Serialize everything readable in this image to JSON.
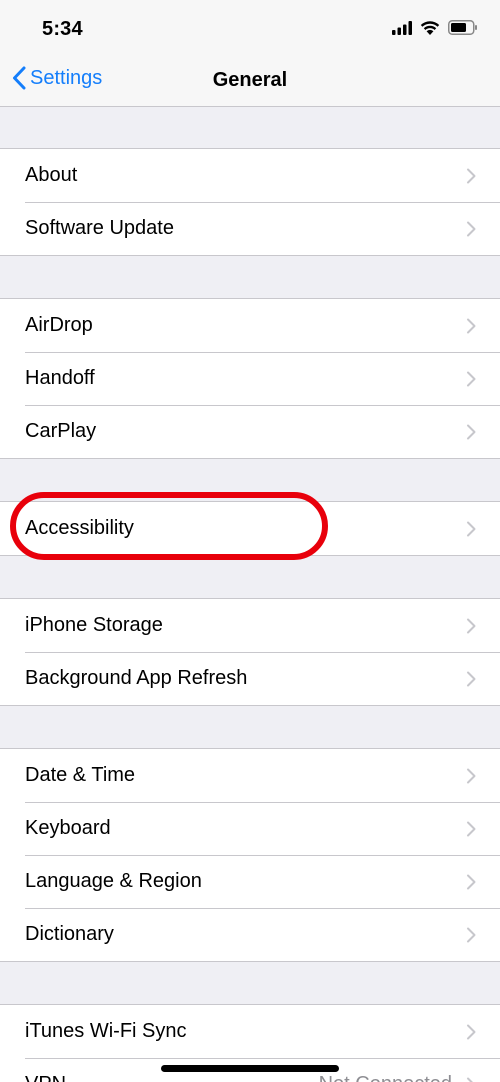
{
  "status": {
    "time": "5:34"
  },
  "nav": {
    "back_label": "Settings",
    "title": "General"
  },
  "groups": [
    {
      "rows": [
        {
          "label": "About"
        },
        {
          "label": "Software Update"
        }
      ]
    },
    {
      "rows": [
        {
          "label": "AirDrop"
        },
        {
          "label": "Handoff"
        },
        {
          "label": "CarPlay"
        }
      ]
    },
    {
      "rows": [
        {
          "label": "Accessibility"
        }
      ]
    },
    {
      "rows": [
        {
          "label": "iPhone Storage"
        },
        {
          "label": "Background App Refresh"
        }
      ]
    },
    {
      "rows": [
        {
          "label": "Date & Time"
        },
        {
          "label": "Keyboard"
        },
        {
          "label": "Language & Region"
        },
        {
          "label": "Dictionary"
        }
      ]
    },
    {
      "rows": [
        {
          "label": "iTunes Wi-Fi Sync"
        },
        {
          "label": "VPN",
          "value": "Not Connected"
        }
      ]
    }
  ],
  "colors": {
    "accent": "#147efb",
    "annotation": "#e8000b",
    "background": "#efeff4"
  },
  "icons": [
    "cellular-signal-icon",
    "wifi-icon",
    "battery-icon",
    "back-chevron-icon",
    "chevron-right-icon"
  ]
}
